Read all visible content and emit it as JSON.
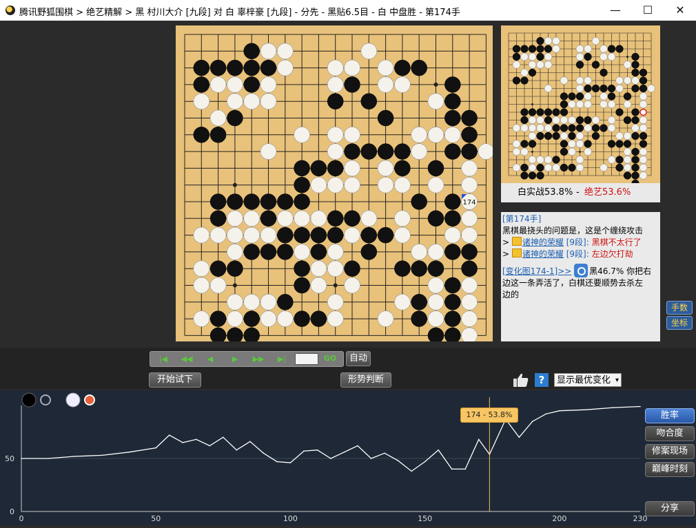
{
  "window": {
    "title": "腾讯野狐围棋 > 绝艺精解 > 黑 村川大介 [九段] 对 白 辜梓豪 [九段] - 分先 - 黑贴6.5目 - 白 中盘胜 - 第174手",
    "minimize": "—",
    "maximize": "☐",
    "close": "✕"
  },
  "board": {
    "size": 19,
    "last_move_label": "174",
    "black": [
      [
        4,
        1
      ],
      [
        1,
        2
      ],
      [
        2,
        2
      ],
      [
        3,
        2
      ],
      [
        4,
        2
      ],
      [
        5,
        2
      ],
      [
        13,
        2
      ],
      [
        14,
        2
      ],
      [
        1,
        3
      ],
      [
        4,
        3
      ],
      [
        10,
        3
      ],
      [
        16,
        3
      ],
      [
        9,
        4
      ],
      [
        11,
        4
      ],
      [
        16,
        4
      ],
      [
        3,
        5
      ],
      [
        12,
        5
      ],
      [
        16,
        5
      ],
      [
        17,
        5
      ],
      [
        1,
        6
      ],
      [
        2,
        6
      ],
      [
        15,
        6
      ],
      [
        17,
        6
      ],
      [
        10,
        7
      ],
      [
        11,
        7
      ],
      [
        12,
        7
      ],
      [
        13,
        7
      ],
      [
        16,
        7
      ],
      [
        17,
        7
      ],
      [
        7,
        8
      ],
      [
        8,
        8
      ],
      [
        9,
        8
      ],
      [
        13,
        8
      ],
      [
        15,
        8
      ],
      [
        7,
        9
      ],
      [
        2,
        10
      ],
      [
        3,
        10
      ],
      [
        4,
        10
      ],
      [
        5,
        10
      ],
      [
        6,
        10
      ],
      [
        7,
        10
      ],
      [
        14,
        10
      ],
      [
        16,
        10
      ],
      [
        2,
        11
      ],
      [
        5,
        11
      ],
      [
        9,
        11
      ],
      [
        10,
        11
      ],
      [
        15,
        11
      ],
      [
        16,
        11
      ],
      [
        6,
        12
      ],
      [
        7,
        12
      ],
      [
        8,
        12
      ],
      [
        9,
        12
      ],
      [
        11,
        12
      ],
      [
        12,
        12
      ],
      [
        4,
        13
      ],
      [
        5,
        13
      ],
      [
        6,
        13
      ],
      [
        8,
        13
      ],
      [
        11,
        13
      ],
      [
        16,
        13
      ],
      [
        17,
        13
      ],
      [
        2,
        14
      ],
      [
        3,
        14
      ],
      [
        7,
        14
      ],
      [
        10,
        14
      ],
      [
        13,
        14
      ],
      [
        14,
        14
      ],
      [
        15,
        14
      ],
      [
        17,
        14
      ],
      [
        7,
        15
      ],
      [
        16,
        15
      ],
      [
        6,
        16
      ],
      [
        14,
        16
      ],
      [
        16,
        16
      ],
      [
        2,
        17
      ],
      [
        4,
        17
      ],
      [
        7,
        17
      ],
      [
        8,
        17
      ],
      [
        14,
        17
      ],
      [
        16,
        17
      ],
      [
        2,
        18
      ],
      [
        3,
        18
      ],
      [
        4,
        18
      ],
      [
        15,
        18
      ],
      [
        16,
        18
      ],
      [
        16,
        19
      ]
    ],
    "white": [
      [
        5,
        1
      ],
      [
        6,
        1
      ],
      [
        11,
        1
      ],
      [
        6,
        2
      ],
      [
        9,
        2
      ],
      [
        10,
        2
      ],
      [
        12,
        2
      ],
      [
        2,
        3
      ],
      [
        3,
        3
      ],
      [
        5,
        3
      ],
      [
        9,
        3
      ],
      [
        12,
        3
      ],
      [
        13,
        3
      ],
      [
        1,
        4
      ],
      [
        3,
        4
      ],
      [
        4,
        4
      ],
      [
        5,
        4
      ],
      [
        15,
        4
      ],
      [
        2,
        5
      ],
      [
        7,
        6
      ],
      [
        9,
        6
      ],
      [
        10,
        6
      ],
      [
        14,
        6
      ],
      [
        15,
        6
      ],
      [
        16,
        6
      ],
      [
        5,
        7
      ],
      [
        9,
        7
      ],
      [
        14,
        7
      ],
      [
        18,
        7
      ],
      [
        10,
        8
      ],
      [
        12,
        8
      ],
      [
        17,
        8
      ],
      [
        8,
        9
      ],
      [
        9,
        9
      ],
      [
        10,
        9
      ],
      [
        12,
        9
      ],
      [
        13,
        9
      ],
      [
        15,
        9
      ],
      [
        17,
        9
      ],
      [
        3,
        11
      ],
      [
        4,
        11
      ],
      [
        6,
        11
      ],
      [
        7,
        11
      ],
      [
        8,
        11
      ],
      [
        11,
        11
      ],
      [
        13,
        11
      ],
      [
        17,
        11
      ],
      [
        1,
        12
      ],
      [
        2,
        12
      ],
      [
        3,
        12
      ],
      [
        4,
        12
      ],
      [
        5,
        12
      ],
      [
        10,
        12
      ],
      [
        13,
        12
      ],
      [
        16,
        12
      ],
      [
        17,
        12
      ],
      [
        3,
        13
      ],
      [
        7,
        13
      ],
      [
        9,
        13
      ],
      [
        14,
        13
      ],
      [
        15,
        13
      ],
      [
        1,
        14
      ],
      [
        8,
        14
      ],
      [
        9,
        14
      ],
      [
        1,
        15
      ],
      [
        2,
        15
      ],
      [
        8,
        15
      ],
      [
        10,
        15
      ],
      [
        15,
        15
      ],
      [
        17,
        15
      ],
      [
        3,
        16
      ],
      [
        4,
        16
      ],
      [
        5,
        16
      ],
      [
        9,
        16
      ],
      [
        13,
        16
      ],
      [
        15,
        16
      ],
      [
        17,
        16
      ],
      [
        1,
        17
      ],
      [
        3,
        17
      ],
      [
        5,
        17
      ],
      [
        6,
        17
      ],
      [
        9,
        17
      ],
      [
        12,
        17
      ],
      [
        15,
        17
      ],
      [
        17,
        17
      ],
      [
        17,
        18
      ]
    ]
  },
  "score": {
    "actual": "白实战53.8%",
    "sep": "-",
    "ai": "绝艺53.6%"
  },
  "comment": {
    "move": "[第174手]",
    "text1": "黑棋最挠头的问题是，这是个缠绕攻击",
    "line1_prefix": ">",
    "line1_user": "诸神的荣耀",
    "line1_rank": "[9段]:",
    "line1_msg": "黑棋不太行了",
    "line2_prefix": ">",
    "line2_user": "诸神的荣耀",
    "line2_rank": "[9段]:",
    "line2_msg": "左边欠打劫",
    "variation_link": "[变化图174-1]>>",
    "variation_rate": "黑46.7%",
    "variation_text1": "你把右",
    "variation_text2": "边这一条弄活了，白棋还要顺势去杀左",
    "variation_text3": "边的"
  },
  "side_buttons": {
    "moves": "手数",
    "coords": "坐标"
  },
  "nav": {
    "first": "|◀",
    "prev5": "◀◀",
    "prev": "◀",
    "next": "▶",
    "next5": "▶▶",
    "last": "▶|",
    "go": "GO",
    "auto": "自动"
  },
  "buttons": {
    "try": "开始试下",
    "judge": "形势判断"
  },
  "select": {
    "value": "显示最优变化",
    "arrow": "▾"
  },
  "graph": {
    "tooltip": "174 - 53.8%",
    "y_labels": [
      "50",
      "0"
    ],
    "x_labels": [
      "0",
      "50",
      "100",
      "150",
      "200",
      "230"
    ],
    "buttons": [
      "胜率",
      "吻合度",
      "修案现场",
      "巅峰时刻",
      "分享"
    ]
  },
  "chart_data": {
    "type": "line",
    "xlabel": "",
    "ylabel": "",
    "xlim": [
      0,
      230
    ],
    "ylim": [
      0,
      100
    ],
    "marker_x": 174,
    "marker_y": 53.8,
    "series": [
      {
        "x": [
          0,
          10,
          20,
          30,
          40,
          50,
          55,
          60,
          65,
          70,
          75,
          80,
          85,
          90,
          95,
          100,
          105,
          110,
          115,
          120,
          125,
          130,
          135,
          140,
          145,
          150,
          155,
          160,
          165,
          170,
          174,
          180,
          185,
          190,
          195,
          200,
          210,
          220,
          230
        ],
        "values": [
          50,
          50,
          52,
          53,
          56,
          60,
          72,
          65,
          68,
          62,
          70,
          58,
          66,
          55,
          47,
          46,
          57,
          58,
          50,
          56,
          62,
          50,
          55,
          48,
          38,
          47,
          58,
          40,
          40,
          68,
          53.8,
          87,
          70,
          85,
          92,
          95,
          96,
          98,
          99
        ]
      }
    ]
  }
}
